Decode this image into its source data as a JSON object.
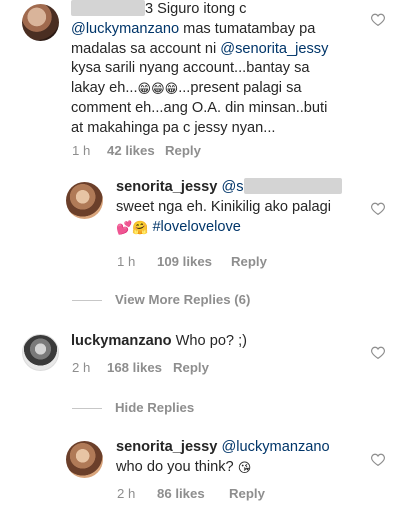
{
  "comments": [
    {
      "prefix_tail": "3 Siguro itong c",
      "mention1": "@luckymanzano",
      "line2_rest": " mas tumatambay pa",
      "line3_start": "madalas sa account ni ",
      "mention2": "@senorita_jessy",
      "line4": "kysa sarili nyang account...bantay sa",
      "line5_start": "lakay eh...",
      "line5_emoji": "😁😁😁",
      "line5_end": "...present palagi sa",
      "line6": "comment eh...ang O.A. din minsan..buti",
      "line7": "at makahinga pa c jessy nyan...",
      "time": "1 h",
      "likes": "42 likes",
      "reply": "Reply"
    },
    {
      "username": "senorita_jessy",
      "mention_start": "@s",
      "line2": "sweet nga eh. Kinikilig ako palagi",
      "emoji": "💕🤗",
      "hashtag": "#lovelovelove",
      "time": "1 h",
      "likes": "109 likes",
      "reply": "Reply"
    },
    {
      "view_more": "View More Replies (6)"
    },
    {
      "username": "luckymanzano",
      "text": "Who po? ;)",
      "time": "2 h",
      "likes": "168 likes",
      "reply": "Reply"
    },
    {
      "hide": "Hide Replies"
    },
    {
      "username": "senorita_jessy",
      "mention": "@luckymanzano",
      "line2": "who do you think? ",
      "emoji": "😘",
      "time": "2 h",
      "likes": "86 likes",
      "reply": "Reply"
    }
  ],
  "colors": {
    "text": "#262626",
    "secondary": "#8e8e8e",
    "mention": "#003569",
    "redaction": "#d4d4d4"
  },
  "icons": {
    "like": "heart-outline-icon"
  }
}
